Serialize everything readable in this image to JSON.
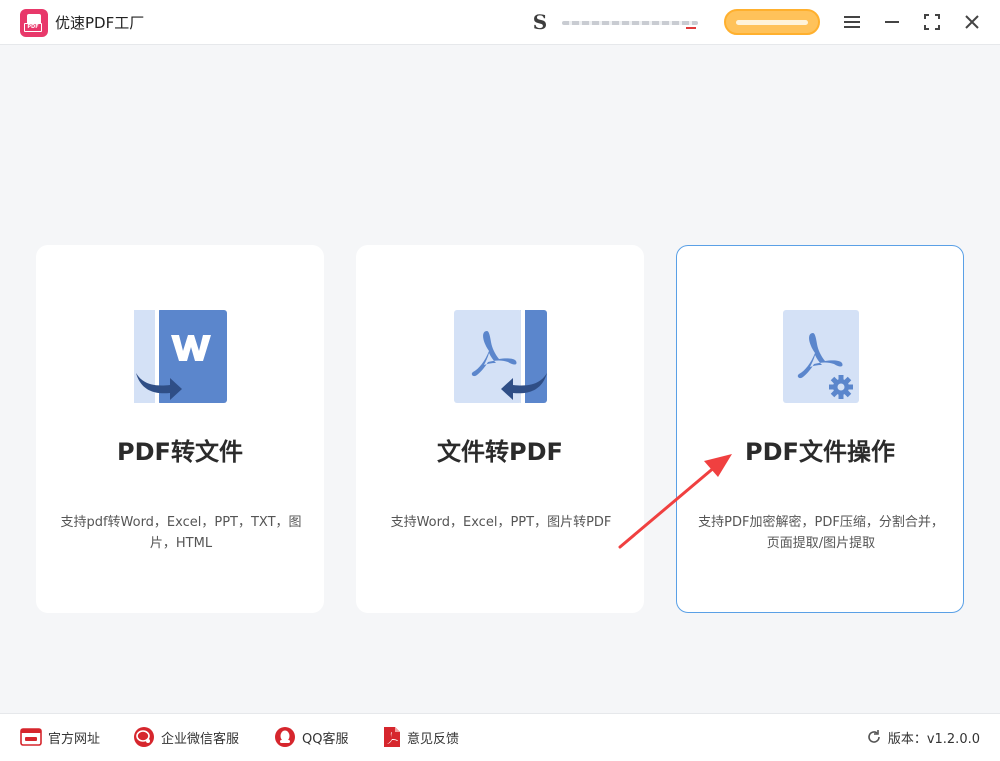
{
  "app": {
    "title": "优速PDF工厂",
    "logo_text": "PDF"
  },
  "header": {
    "user_badge_letter": "S"
  },
  "cards": [
    {
      "title": "PDF转文件",
      "description": "支持pdf转Word，Excel，PPT，TXT，图片，HTML",
      "icon": "pdf-to-word-icon"
    },
    {
      "title": "文件转PDF",
      "description": "支持Word，Excel，PPT，图片转PDF",
      "icon": "file-to-pdf-icon"
    },
    {
      "title": "PDF文件操作",
      "description": "支持PDF加密解密，PDF压缩，分割合并，页面提取/图片提取",
      "icon": "pdf-settings-icon"
    }
  ],
  "footer": {
    "links": [
      {
        "label": "官方网址",
        "icon": "website-icon"
      },
      {
        "label": "企业微信客服",
        "icon": "wecom-icon"
      },
      {
        "label": "QQ客服",
        "icon": "qq-icon"
      },
      {
        "label": "意见反馈",
        "icon": "feedback-icon"
      }
    ],
    "version": "版本：v1.2.0.0"
  },
  "colors": {
    "brand": "#e8386a",
    "card_active_border": "#5aa0e6",
    "icon_blue": "#5b86cc",
    "icon_light": "#d4e1f6",
    "footer_icon": "#d6262d",
    "annotation_arrow": "#f04040"
  }
}
